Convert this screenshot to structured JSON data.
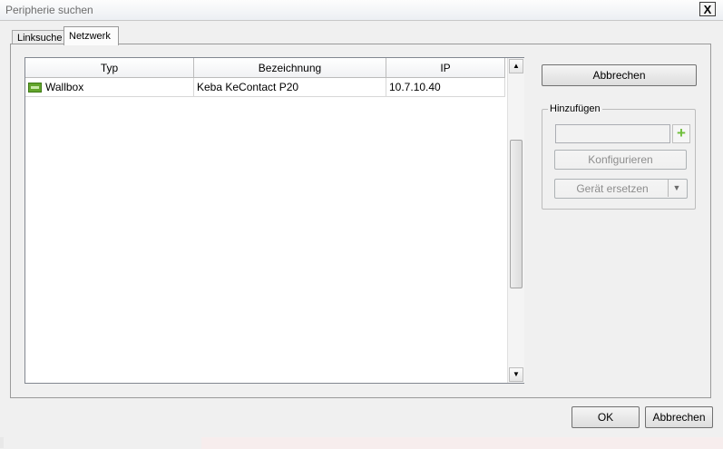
{
  "window": {
    "title": "Peripherie suchen",
    "close_label": "X"
  },
  "tabs": [
    {
      "label": "Linksuche",
      "active": false
    },
    {
      "label": "Netzwerk",
      "active": true
    }
  ],
  "table": {
    "columns": [
      "Typ",
      "Bezeichnung",
      "IP"
    ],
    "rows": [
      {
        "typ": "Wallbox",
        "bezeichnung": "Keba KeContact P20",
        "ip": "10.7.10.40"
      }
    ]
  },
  "scrollbar": {
    "up_arrow": "▲",
    "down_arrow": "▼"
  },
  "side": {
    "cancel_label": "Abbrechen",
    "group_label": "Hinzufügen",
    "add_symbol": "+",
    "configure_label": "Konfigurieren",
    "replace_label": "Gerät ersetzen",
    "replace_arrow": "▼"
  },
  "footer": {
    "ok_label": "OK",
    "cancel_label": "Abbrechen"
  }
}
